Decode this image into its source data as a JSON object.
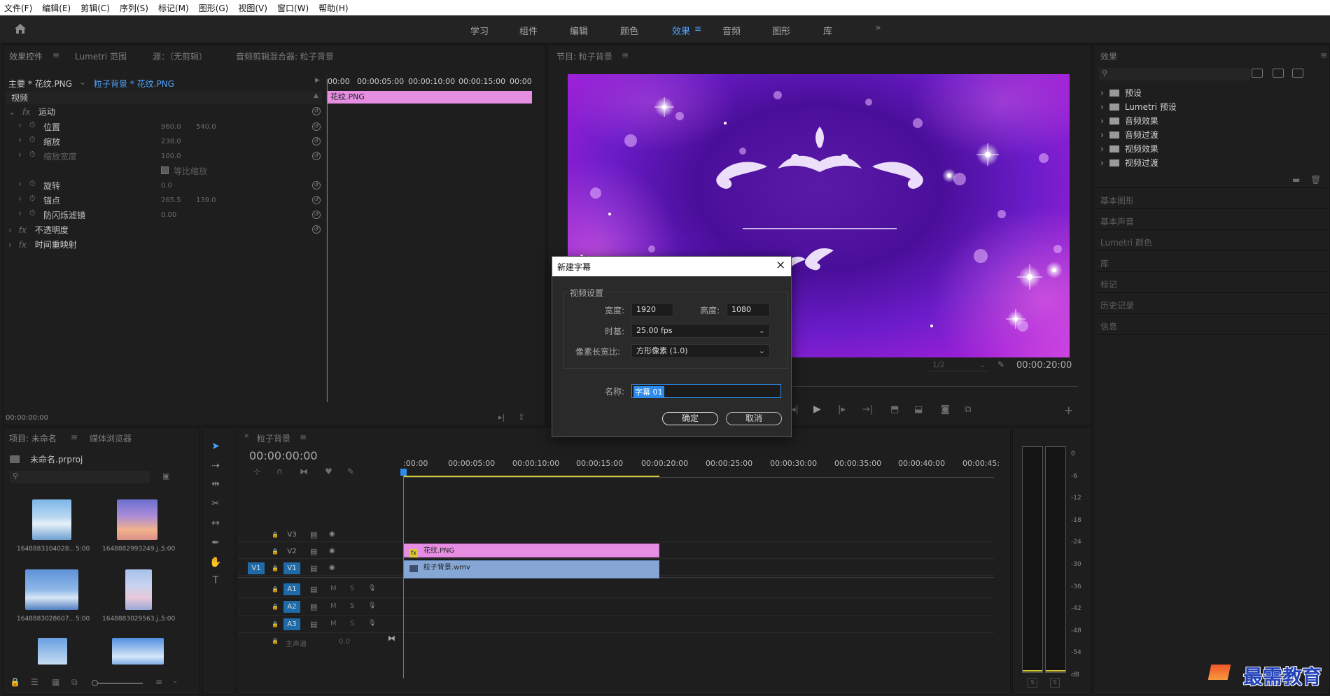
{
  "menu": [
    "文件(F)",
    "编辑(E)",
    "剪辑(C)",
    "序列(S)",
    "标记(M)",
    "图形(G)",
    "视图(V)",
    "窗口(W)",
    "帮助(H)"
  ],
  "workspaces": [
    "学习",
    "组件",
    "编辑",
    "颜色",
    "效果",
    "音频",
    "图形",
    "库"
  ],
  "workspace_active": "效果",
  "effect_controls": {
    "tabs": [
      "效果控件",
      "Lumetri 范围",
      "源：（无剪辑）",
      "音频剪辑混合器: 粒子背景"
    ],
    "master_clip": "主要 * 花纹.PNG",
    "seq_clip": "粒子背景 * 花纹.PNG",
    "ruler": [
      "00:00",
      "00:00:05:00",
      "00:00:10:00",
      "00:00:15:00",
      "00:00"
    ],
    "clip_label": "花纹.PNG",
    "section": "视频",
    "motion": "运动",
    "props": [
      {
        "name": "位置",
        "v1": "960.0",
        "v2": "540.0"
      },
      {
        "name": "缩放",
        "v1": "238.0",
        "v2": ""
      },
      {
        "name": "缩放宽度",
        "v1": "100.0",
        "v2": ""
      },
      {
        "name": "等比缩放",
        "v1": "",
        "v2": ""
      },
      {
        "name": "旋转",
        "v1": "0.0",
        "v2": ""
      },
      {
        "name": "锚点",
        "v1": "265.5",
        "v2": "139.0"
      },
      {
        "name": "防闪烁滤镜",
        "v1": "0.00",
        "v2": ""
      }
    ],
    "opacity": "不透明度",
    "time_remap": "时间重映射",
    "timecode": "00:00:00:00"
  },
  "program": {
    "title": "节目: 粒子背景",
    "zoom": "1/2",
    "duration": "00:00:20:00"
  },
  "project": {
    "tabs": [
      "项目: 未命名",
      "媒体浏览器"
    ],
    "file": "未命名.prproj",
    "items": [
      {
        "name": "1648883104028...",
        "dur": "5:00"
      },
      {
        "name": "1648882993249.j...",
        "dur": "5:00"
      },
      {
        "name": "1648883028607...",
        "dur": "5:00"
      },
      {
        "name": "1648883029563.j...",
        "dur": "5:00"
      }
    ]
  },
  "timeline": {
    "tab": "粒子背景",
    "timecode": "00:00:00:00",
    "ruler": [
      ":00:00",
      "00:00:05:00",
      "00:00:10:00",
      "00:00:15:00",
      "00:00:20:00",
      "00:00:25:00",
      "00:00:30:00",
      "00:00:35:00",
      "00:00:40:00",
      "00:00:45:"
    ],
    "tracks_v": [
      "V3",
      "V2",
      "V1"
    ],
    "tracks_a": [
      "A1",
      "A2",
      "A3"
    ],
    "master": "主声道",
    "master_val": "0.0",
    "source_patch": "V1",
    "clip_v2": "花纹.PNG",
    "clip_v1": "粒子背景.wmv",
    "m_label": "M",
    "s_label": "S"
  },
  "meter": {
    "labels": [
      "0",
      "-6",
      "-12",
      "-18",
      "-24",
      "-30",
      "-36",
      "-42",
      "-48",
      "-54",
      "dB"
    ]
  },
  "effects": {
    "title": "效果",
    "items": [
      "预设",
      "Lumetri 预设",
      "音频效果",
      "音频过渡",
      "视频效果",
      "视频过渡"
    ],
    "panels": [
      "基本图形",
      "基本声音",
      "Lumetri 颜色",
      "库",
      "标记",
      "历史记录",
      "信息"
    ]
  },
  "dialog": {
    "title": "新建字幕",
    "group": "视频设置",
    "width_label": "宽度:",
    "width_val": "1920",
    "height_label": "高度:",
    "height_val": "1080",
    "timebase_label": "时基:",
    "timebase_val": "25.00 fps",
    "par_label": "像素长宽比:",
    "par_val": "方形像素 (1.0)",
    "name_label": "名称:",
    "name_val": "字幕 01",
    "ok": "确定",
    "cancel": "取消"
  },
  "watermark": "最需教育",
  "colors": {
    "accent": "#2d8ceb",
    "clip_pink": "#e58ee2",
    "clip_blue": "#86a7d6",
    "track_blue": "#1f6aa8"
  }
}
